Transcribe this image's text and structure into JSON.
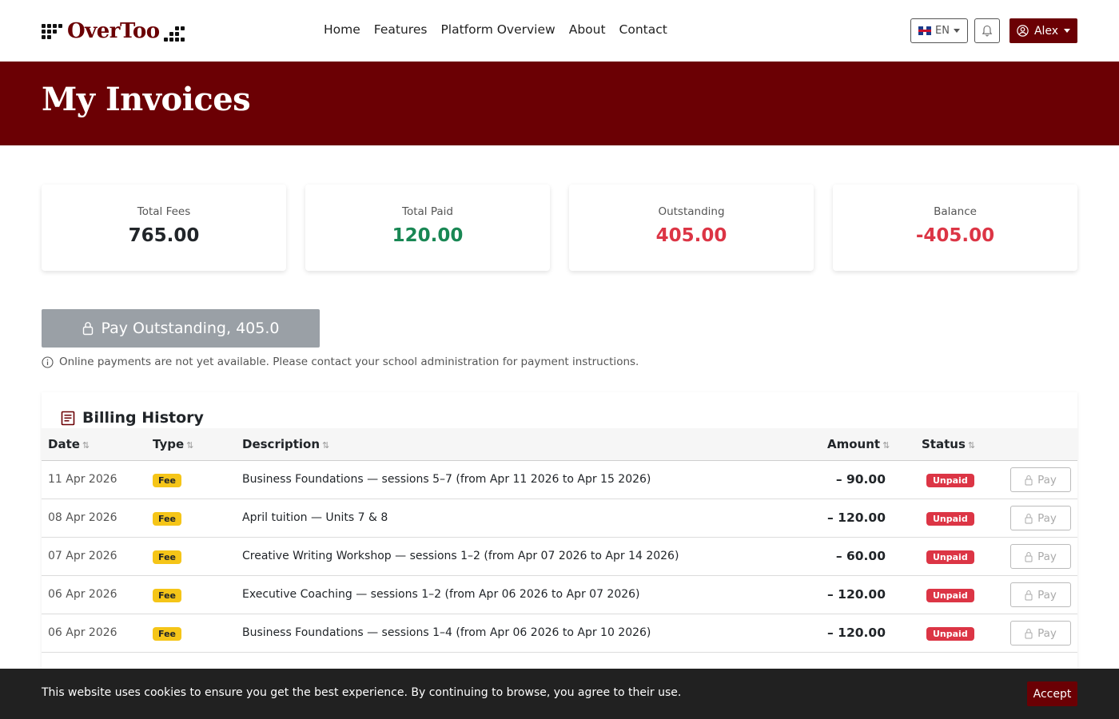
{
  "brand": {
    "name": "OverToo",
    "color": "#6b0004"
  },
  "nav": {
    "links": [
      "Home",
      "Features",
      "Platform Overview",
      "About",
      "Contact"
    ],
    "language": "EN",
    "user": "Alex"
  },
  "page": {
    "title": "My Invoices"
  },
  "summary": [
    {
      "label": "Total Fees",
      "value": "765.00",
      "color": "#212529"
    },
    {
      "label": "Total Paid",
      "value": "120.00",
      "color": "#198754"
    },
    {
      "label": "Outstanding",
      "value": "405.00",
      "color": "#dc3545"
    },
    {
      "label": "Balance",
      "value": "-405.00",
      "color": "#dc3545"
    }
  ],
  "pay_outstanding": {
    "label": "Pay Outstanding, 405.0",
    "notice": "Online payments are not yet available. Please contact your school administration for payment instructions."
  },
  "billing": {
    "title": "Billing History",
    "columns": {
      "date": "Date",
      "type": "Type",
      "description": "Description",
      "amount": "Amount",
      "status": "Status"
    },
    "rows": [
      {
        "date": "11 Apr 2026",
        "type": "Fee",
        "description": "Business Foundations — sessions 5–7 (from Apr 11 2026 to Apr 15 2026)",
        "amount": "– 90.00",
        "status": "Unpaid",
        "action": "Pay"
      },
      {
        "date": "08 Apr 2026",
        "type": "Fee",
        "description": "April tuition — Units 7 & 8",
        "amount": "– 120.00",
        "status": "Unpaid",
        "action": "Pay"
      },
      {
        "date": "07 Apr 2026",
        "type": "Fee",
        "description": "Creative Writing Workshop — sessions 1–2 (from Apr 07 2026 to Apr 14 2026)",
        "amount": "– 60.00",
        "status": "Unpaid",
        "action": "Pay"
      },
      {
        "date": "06 Apr 2026",
        "type": "Fee",
        "description": "Executive Coaching — sessions 1–2 (from Apr 06 2026 to Apr 07 2026)",
        "amount": "– 120.00",
        "status": "Unpaid",
        "action": "Pay"
      },
      {
        "date": "06 Apr 2026",
        "type": "Fee",
        "description": "Business Foundations — sessions 1–4 (from Apr 06 2026 to Apr 10 2026)",
        "amount": "– 120.00",
        "status": "Unpaid",
        "action": "Pay"
      }
    ]
  },
  "cookie": {
    "text": "This website uses cookies to ensure you get the best experience. By continuing to browse, you agree to their use.",
    "accept": "Accept"
  }
}
